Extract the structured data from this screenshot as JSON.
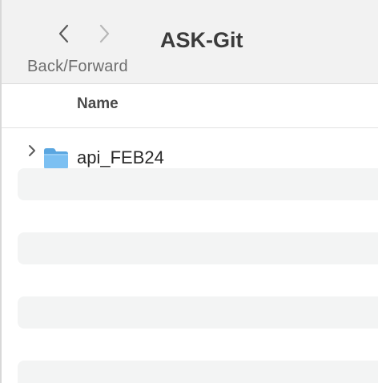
{
  "toolbar": {
    "title": "ASK-Git",
    "nav_label": "Back/Forward"
  },
  "columns": {
    "name_header": "Name"
  },
  "items": [
    {
      "label": "api_FEB24",
      "type": "folder",
      "expanded": false
    }
  ],
  "colors": {
    "toolbar_bg": "#f2f2f2",
    "stripe_bg": "#f3f4f4",
    "folder_blue": "#6db7ee"
  }
}
